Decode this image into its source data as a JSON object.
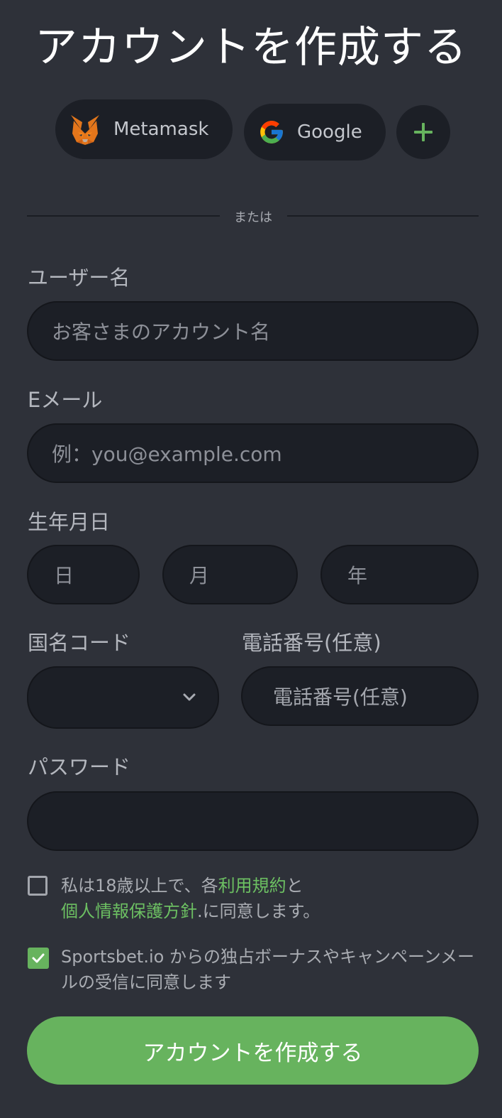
{
  "title": "アカウントを作成する",
  "social": {
    "metamask_label": "Metamask",
    "google_label": "Google",
    "more_icon": "plus-icon"
  },
  "divider_text": "または",
  "username": {
    "label": "ユーザー名",
    "placeholder": "お客さまのアカウント名"
  },
  "email": {
    "label": "Eメール",
    "placeholder": "例：you@example.com"
  },
  "birthdate": {
    "label": "生年月日",
    "day_placeholder": "日",
    "month_placeholder": "月",
    "year_placeholder": "年"
  },
  "country_code": {
    "label": "国名コード",
    "value": "",
    "chevron_icon": "chevron-down-icon"
  },
  "phone": {
    "label": "電話番号(任意)",
    "placeholder": "電話番号(任意)"
  },
  "password": {
    "label": "パスワード",
    "value": ""
  },
  "terms": {
    "checked": false,
    "text_before": "私は18歳以上で、各",
    "terms_link": "利用規約",
    "text_and": "と",
    "privacy_link": "個人情報保護方針",
    "text_after": ".に同意します。"
  },
  "marketing": {
    "checked": true,
    "text": "Sportsbet.io からの独占ボーナスやキャンペーンメールの受信に同意します"
  },
  "submit_label": "アカウントを作成する",
  "colors": {
    "background": "#2e3139",
    "field": "#1c1f26",
    "accent_green": "#67b35e",
    "link_green": "#6cbf62"
  }
}
